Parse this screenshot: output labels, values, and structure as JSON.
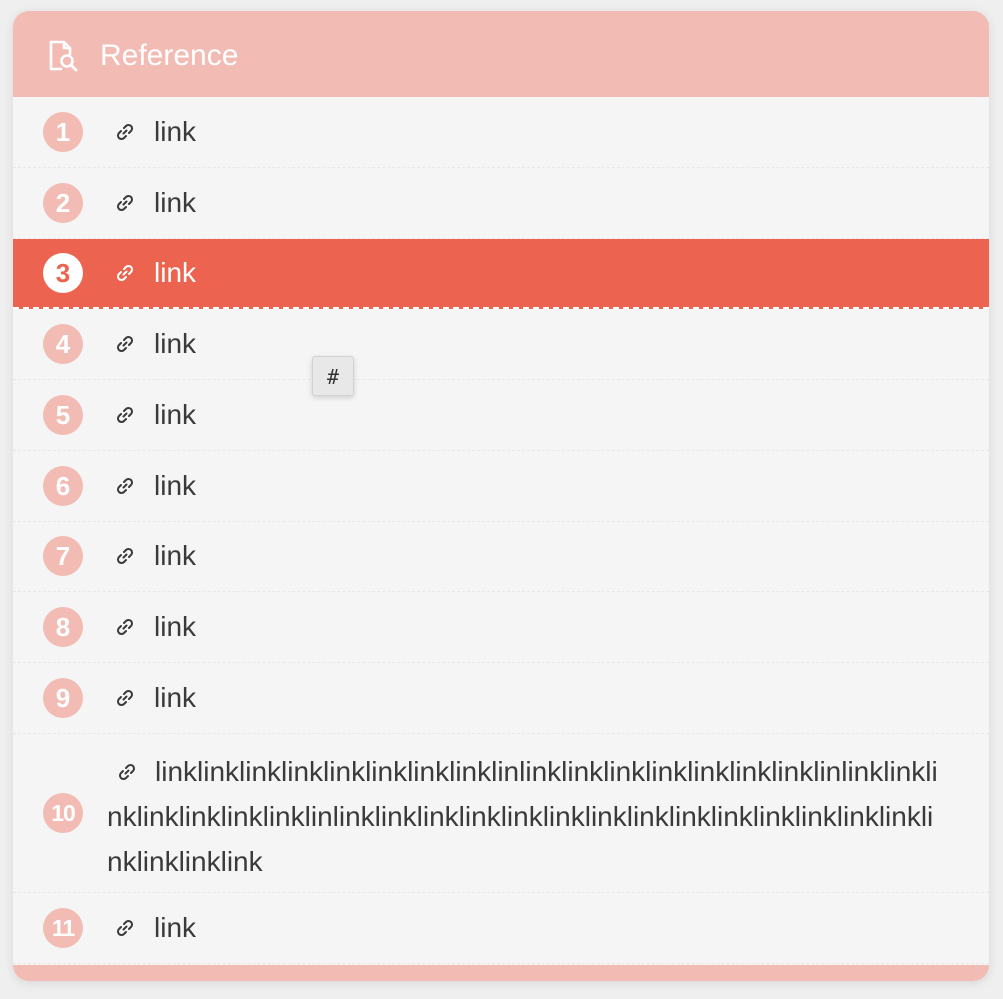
{
  "header": {
    "title": "Reference",
    "icon": "document-search-icon"
  },
  "colors": {
    "header_bg": "#f2bcb5",
    "active_bg": "#ec6450",
    "badge_bg": "#f2bcb5"
  },
  "references": [
    {
      "number": "1",
      "label": "link",
      "active": false
    },
    {
      "number": "2",
      "label": "link",
      "active": false
    },
    {
      "number": "3",
      "label": "link",
      "active": true
    },
    {
      "number": "4",
      "label": "link",
      "active": false
    },
    {
      "number": "5",
      "label": "link",
      "active": false
    },
    {
      "number": "6",
      "label": "link",
      "active": false
    },
    {
      "number": "7",
      "label": "link",
      "active": false
    },
    {
      "number": "8",
      "label": "link",
      "active": false
    },
    {
      "number": "9",
      "label": "link",
      "active": false
    },
    {
      "number": "10",
      "label": "linklinklinklinklinklinklinklinklinlinklinklinklinklinklinklinklinlinklinklinklinklinklinklinklinlinklinklinklinklinklinklinklinklinklinklinklinklinklinklinklinklinklink",
      "active": false
    },
    {
      "number": "11",
      "label": "link",
      "active": false
    }
  ],
  "tooltip": {
    "text": "#"
  }
}
